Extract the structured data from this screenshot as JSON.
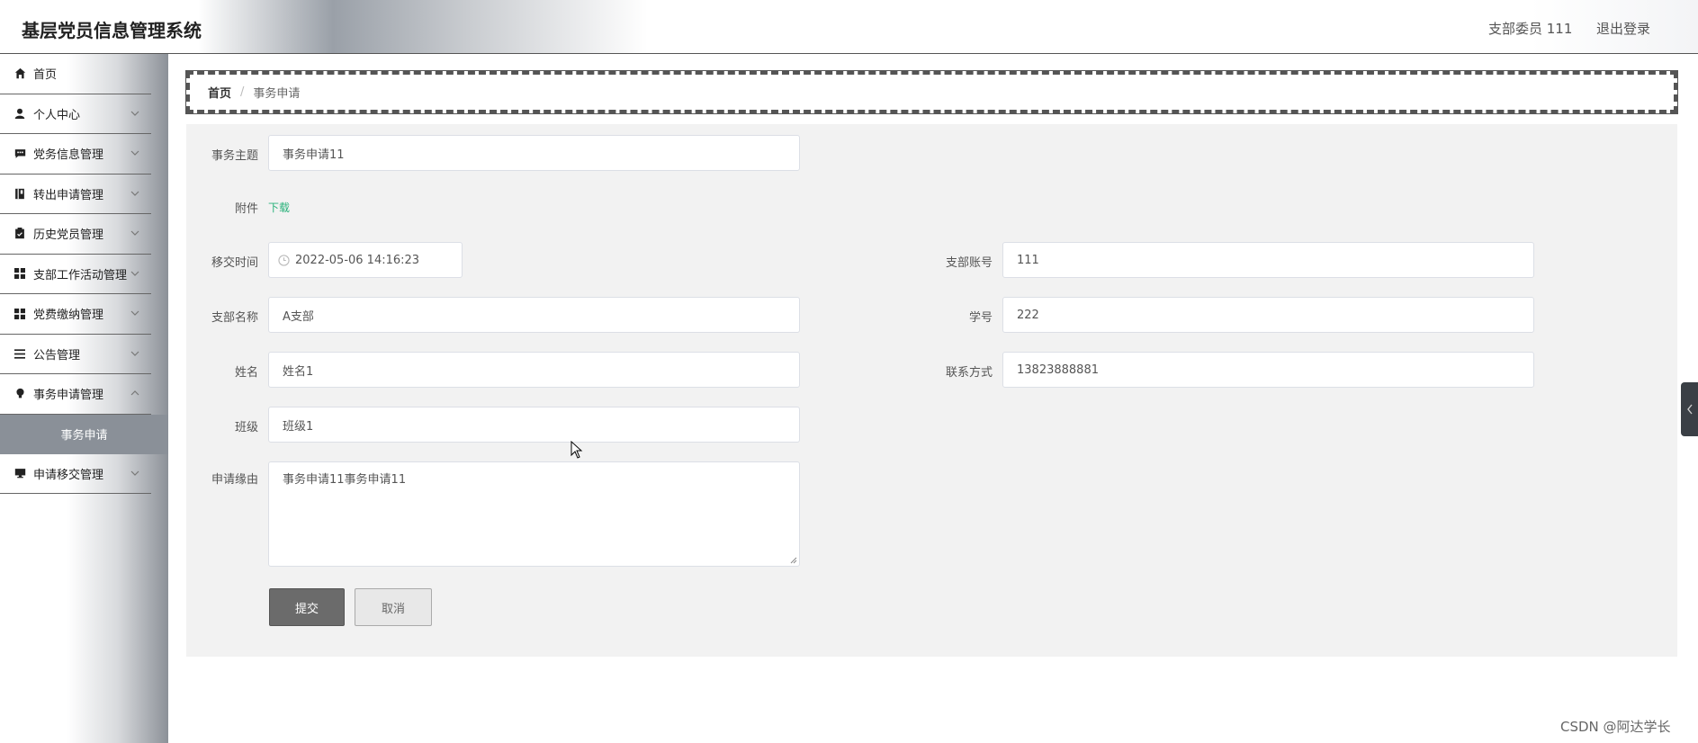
{
  "header": {
    "title": "基层党员信息管理系统",
    "user": "支部委员 111",
    "logout": "退出登录"
  },
  "sidebar": {
    "items": [
      {
        "label": "首页",
        "icon": "home-icon"
      },
      {
        "label": "个人中心",
        "icon": "user-icon"
      },
      {
        "label": "党务信息管理",
        "icon": "message-icon"
      },
      {
        "label": "转出申请管理",
        "icon": "notebook-icon"
      },
      {
        "label": "历史党员管理",
        "icon": "clipboard-icon"
      },
      {
        "label": "支部工作活动管理",
        "icon": "grid-icon"
      },
      {
        "label": "党费缴纳管理",
        "icon": "grid-icon"
      },
      {
        "label": "公告管理",
        "icon": "list-icon"
      },
      {
        "label": "事务申请管理",
        "icon": "bulb-icon"
      },
      {
        "label": "申请移交管理",
        "icon": "monitor-icon"
      }
    ],
    "active_sub": "事务申请"
  },
  "breadcrumb": {
    "home": "首页",
    "separator": "/",
    "current": "事务申请"
  },
  "form": {
    "subject_label": "事务主题",
    "subject_value": "事务申请11",
    "attachment_label": "附件",
    "attachment_link": "下载",
    "time_label": "移交时间",
    "time_value": "2022-05-06 14:16:23",
    "branch_account_label": "支部账号",
    "branch_account_value": "111",
    "branch_name_label": "支部名称",
    "branch_name_value": "A支部",
    "student_id_label": "学号",
    "student_id_value": "222",
    "name_label": "姓名",
    "name_value": "姓名1",
    "contact_label": "联系方式",
    "contact_value": "13823888881",
    "class_label": "班级",
    "class_value": "班级1",
    "reason_label": "申请缘由",
    "reason_value": "事务申请11事务申请11",
    "submit": "提交",
    "cancel": "取消"
  },
  "watermark": "CSDN @阿达学长",
  "colors": {
    "link_green": "#2ab27b",
    "submit_bg": "#6b6b6b",
    "form_bg": "#f2f2f2",
    "submenu_bg": "#8a9098"
  }
}
